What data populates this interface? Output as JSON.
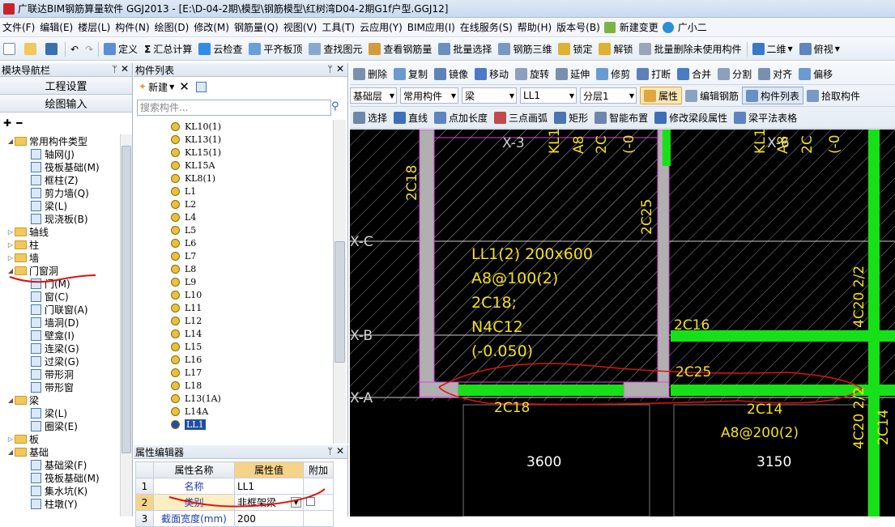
{
  "window": {
    "title": "广联达BIM钢筋算量软件 GGJ2013 - [E:\\D-04-2期\\模型\\钢筋模型\\红树湾D04-2期G1f户型.GGJ12]"
  },
  "menu": [
    "文件(F)",
    "编辑(E)",
    "楼层(L)",
    "构件(N)",
    "绘图(D)",
    "修改(M)",
    "钢筋量(Q)",
    "视图(V)",
    "工具(T)",
    "云应用(Y)",
    "BIM应用(I)",
    "在线服务(S)",
    "帮助(H)",
    "版本号(B)",
    "新建变更",
    "广小二"
  ],
  "toolbar": [
    "定义",
    "汇总计算",
    "云检查",
    "平齐板顶",
    "查找图元",
    "查看钢筋量",
    "批量选择",
    "钢筋三维",
    "锁定",
    "解锁",
    "批量删除未使用构件",
    "二维",
    "俯视"
  ],
  "nav": {
    "title": "模块导航栏",
    "buttons": [
      "工程设置",
      "绘图输入"
    ],
    "tree": [
      {
        "label": "常用构件类型",
        "level": 0,
        "folder": true,
        "open": true
      },
      {
        "label": "轴网(J)",
        "level": 1
      },
      {
        "label": "筏板基础(M)",
        "level": 1
      },
      {
        "label": "框柱(Z)",
        "level": 1
      },
      {
        "label": "剪力墙(Q)",
        "level": 1
      },
      {
        "label": "梁(L)",
        "level": 1
      },
      {
        "label": "现浇板(B)",
        "level": 1
      },
      {
        "label": "轴线",
        "level": 0,
        "folder": true
      },
      {
        "label": "柱",
        "level": 0,
        "folder": true
      },
      {
        "label": "墙",
        "level": 0,
        "folder": true
      },
      {
        "label": "门窗洞",
        "level": 0,
        "folder": true,
        "open": true
      },
      {
        "label": "门(M)",
        "level": 1
      },
      {
        "label": "窗(C)",
        "level": 1
      },
      {
        "label": "门联窗(A)",
        "level": 1
      },
      {
        "label": "墙洞(D)",
        "level": 1
      },
      {
        "label": "壁龛(I)",
        "level": 1
      },
      {
        "label": "连梁(G)",
        "level": 1
      },
      {
        "label": "过梁(G)",
        "level": 1
      },
      {
        "label": "带形洞",
        "level": 1
      },
      {
        "label": "带形窗",
        "level": 1
      },
      {
        "label": "梁",
        "level": 0,
        "folder": true,
        "open": true
      },
      {
        "label": "梁(L)",
        "level": 1
      },
      {
        "label": "圈梁(E)",
        "level": 1
      },
      {
        "label": "板",
        "level": 0,
        "folder": true
      },
      {
        "label": "基础",
        "level": 0,
        "folder": true,
        "open": true
      },
      {
        "label": "基础梁(F)",
        "level": 1
      },
      {
        "label": "筏板基础(M)",
        "level": 1
      },
      {
        "label": "集水坑(K)",
        "level": 1
      },
      {
        "label": "柱墩(Y)",
        "level": 1
      }
    ]
  },
  "component_list": {
    "title": "构件列表",
    "new_label": "新建",
    "search_placeholder": "搜索构件...",
    "items": [
      "KL10(1)",
      "KL13(1)",
      "KL15(1)",
      "KL15A",
      "KL8(1)",
      "L1",
      "L2",
      "L4",
      "L5",
      "L6",
      "L7",
      "L8",
      "L9",
      "L10",
      "L11",
      "L12",
      "L14",
      "L15",
      "L16",
      "L17",
      "L18",
      "L13(1A)",
      "L14A",
      "LL1"
    ],
    "selected": "LL1"
  },
  "property_editor": {
    "title": "属性编辑器",
    "headers": [
      "属性名称",
      "属性值",
      "附加"
    ],
    "rows": [
      {
        "num": "1",
        "name": "名称",
        "value": "LL1"
      },
      {
        "num": "2",
        "name": "类别",
        "value": "非框架梁"
      },
      {
        "num": "3",
        "name": "截面宽度(mm)",
        "value": "200"
      }
    ]
  },
  "draw_toolbar": {
    "row1": [
      "删除",
      "复制",
      "镜像",
      "移动",
      "旋转",
      "延伸",
      "修剪",
      "打断",
      "合并",
      "分割",
      "对齐",
      "偏移"
    ],
    "floor": "基础层",
    "category": "常用构件",
    "type": "梁",
    "component": "LL1",
    "layer": "分层1",
    "row2_buttons": [
      "属性",
      "编辑钢筋",
      "构件列表",
      "拾取构件"
    ],
    "row3": [
      "选择",
      "直线",
      "点加长度",
      "三点画弧",
      "矩形",
      "智能布置",
      "修改梁段属性",
      "梁平法表格"
    ]
  },
  "cad": {
    "axis_labels": [
      "X-3",
      "X-6",
      "X-C",
      "X-B",
      "X-A"
    ],
    "annotation": [
      "LL1(2) 200x600",
      "A8@100(2)",
      "2C18;",
      "N4C12",
      "(-0.050)"
    ],
    "rebar_labels": [
      "2C18",
      "2C25",
      "2C16",
      "2C25",
      "2C18",
      "2C14",
      "A8@200(2)",
      "4C20 2/2",
      "4C20 2/2",
      "2C14"
    ],
    "dims": [
      "3600",
      "3150"
    ],
    "top_labels": [
      "KL1",
      "A8",
      "2C",
      "(-0",
      "KL1",
      "A8",
      "2C",
      "(-0"
    ]
  }
}
